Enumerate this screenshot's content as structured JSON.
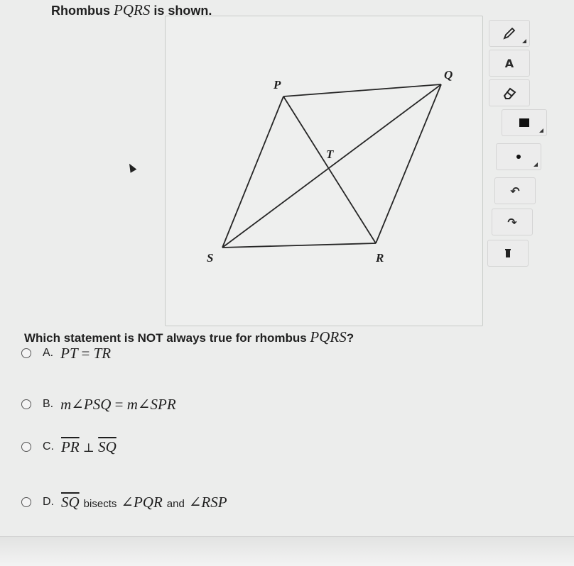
{
  "question": {
    "header_prefix": "Rhombus",
    "header_name": "PQRS",
    "header_suffix": "is shown.",
    "prompt_prefix": "Which statement is NOT always true for rhombus",
    "prompt_name": "PQRS",
    "prompt_suffix": "?"
  },
  "figure": {
    "vertex_labels": {
      "P": "P",
      "Q": "Q",
      "R": "R",
      "S": "S",
      "T": "T"
    }
  },
  "toolbar": {
    "tools": [
      {
        "icon": "pencil-icon"
      },
      {
        "icon": "text-tool-icon",
        "glyph": "A"
      },
      {
        "icon": "eraser-icon"
      },
      {
        "icon": "square-color-icon"
      },
      {
        "icon": "dot-size-icon"
      },
      {
        "icon": "undo-icon",
        "glyph": "↶"
      },
      {
        "icon": "redo-icon",
        "glyph": "↷"
      },
      {
        "icon": "trash-icon"
      }
    ]
  },
  "choices": [
    {
      "letter": "A.",
      "expr_left": "PT",
      "op": "=",
      "expr_right": "TR"
    },
    {
      "letter": "B.",
      "expr_left": "m∠PSQ",
      "op": "=",
      "expr_right": "m∠SPR"
    },
    {
      "letter": "C.",
      "expr_left": "PR",
      "op": "⊥",
      "expr_right": "SQ"
    },
    {
      "letter": "D.",
      "segment": "SQ",
      "word": "bisects",
      "angle1": "∠PQR",
      "and": "and",
      "angle2": "∠RSP"
    }
  ]
}
